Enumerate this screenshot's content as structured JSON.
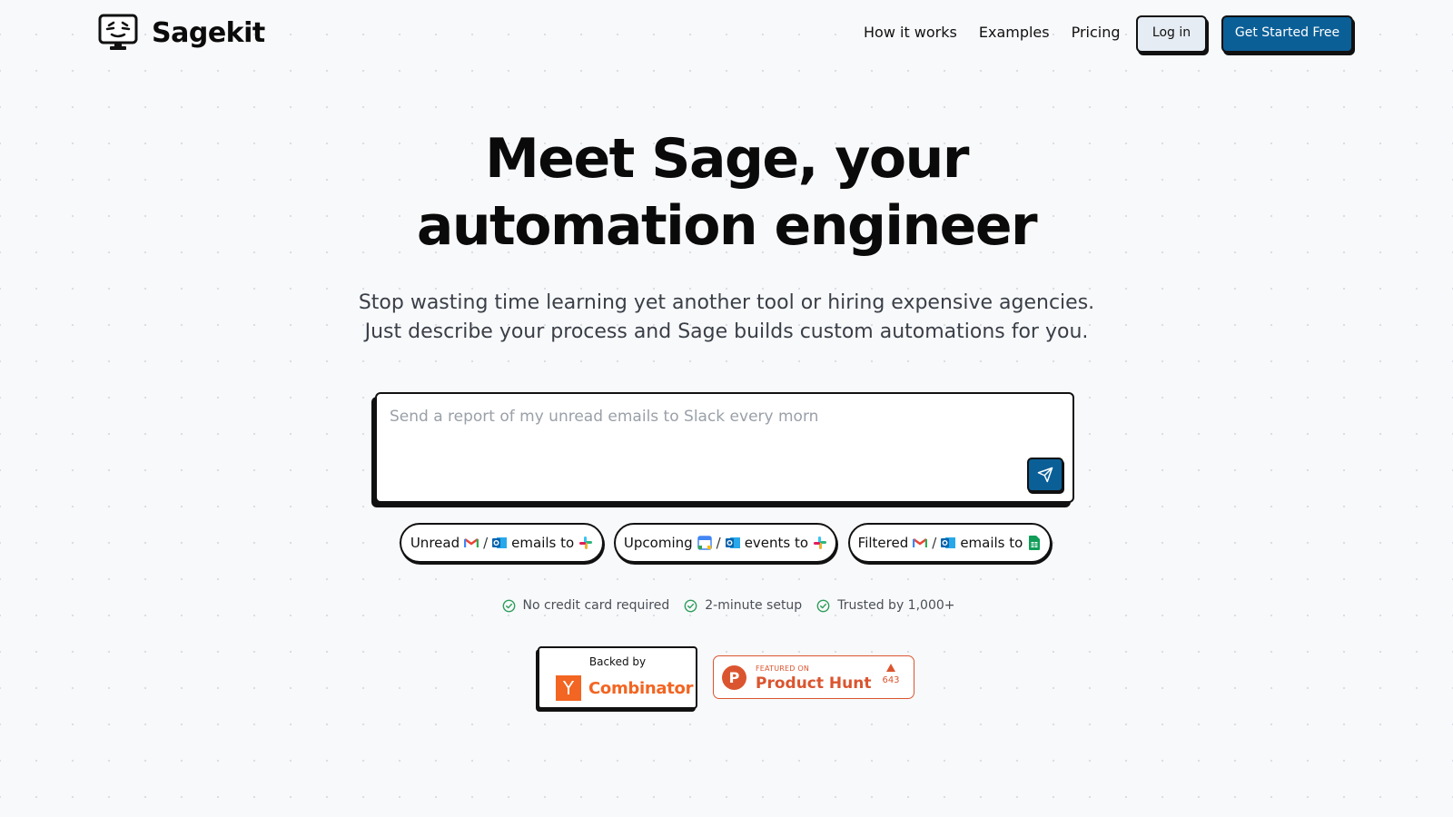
{
  "nav": {
    "brand": "Sagekit",
    "links": [
      "How it works",
      "Examples",
      "Pricing"
    ],
    "login_label": "Log in",
    "cta_label": "Get Started Free"
  },
  "hero": {
    "title_line1": "Meet Sage, your",
    "title_line2": "automation engineer",
    "subtitle_line1": "Stop wasting time learning yet another tool or hiring expensive agencies.",
    "subtitle_line2": "Just describe your process and Sage builds custom automations for you."
  },
  "prompt": {
    "placeholder": "Send a report of my unread emails to Slack every morn",
    "send_icon": "send-icon"
  },
  "chips": [
    {
      "prefix": "Unread",
      "icons": [
        "gmail-icon",
        "outlook-icon"
      ],
      "suffix": "emails to",
      "target_icon": "slack-icon"
    },
    {
      "prefix": "Upcoming",
      "icons": [
        "google-calendar-icon",
        "outlook-icon"
      ],
      "suffix": "events to",
      "target_icon": "slack-icon"
    },
    {
      "prefix": "Filtered",
      "icons": [
        "gmail-icon",
        "outlook-icon"
      ],
      "suffix": "emails to",
      "target_icon": "google-sheets-icon"
    }
  ],
  "chip_separator": "/",
  "trust": [
    "No credit card required",
    "2-minute setup",
    "Trusted by 1,000+"
  ],
  "badges": {
    "yc_top": "Backed by",
    "yc_logo": "Y",
    "yc_name": "Combinator",
    "ph_logo": "P",
    "ph_featured": "FEATURED ON",
    "ph_name": "Product Hunt",
    "ph_votes": "643"
  },
  "colors": {
    "accent": "#0b5f97",
    "yc_orange": "#f26522",
    "ph_orange": "#da552f",
    "check_green": "#2e9e5b"
  }
}
